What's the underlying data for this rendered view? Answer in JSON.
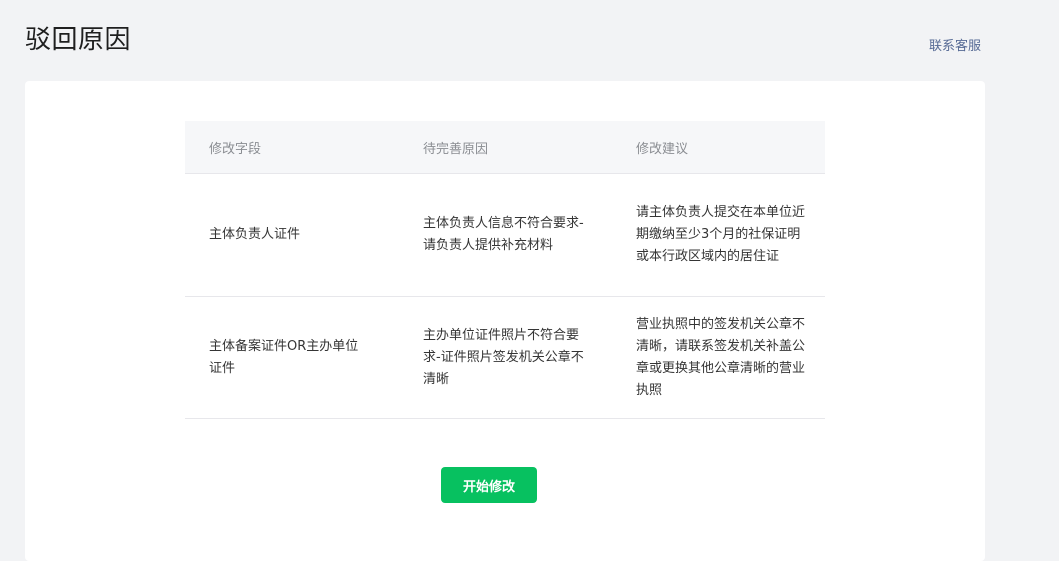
{
  "page": {
    "title": "驳回原因",
    "contact_link": "联系客服"
  },
  "table": {
    "headers": {
      "field": "修改字段",
      "reason": "待完善原因",
      "suggestion": "修改建议"
    },
    "rows": [
      {
        "field": "主体负责人证件",
        "reason": "主体负责人信息不符合要求-请负责人提供补充材料",
        "suggestion": "请主体负责人提交在本单位近期缴纳至少3个月的社保证明或本行政区域内的居住证"
      },
      {
        "field": "主体备案证件OR主办单位证件",
        "reason": "主办单位证件照片不符合要求-证件照片签发机关公章不清晰",
        "suggestion": "营业执照中的签发机关公章不清晰，请联系签发机关补盖公章或更换其他公章清晰的营业执照"
      }
    ]
  },
  "actions": {
    "start_edit_label": "开始修改"
  },
  "colors": {
    "primary": "#07c160",
    "link": "#576b95",
    "background": "#f2f3f5"
  }
}
